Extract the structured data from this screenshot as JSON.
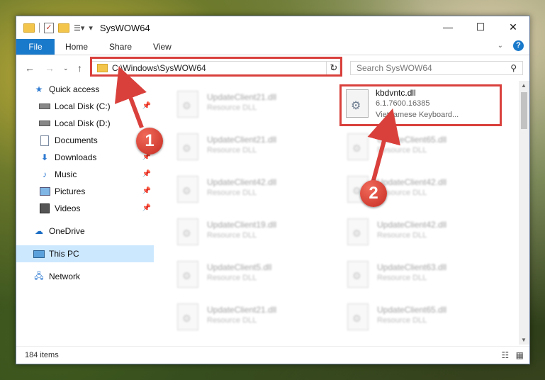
{
  "window": {
    "title": "SysWOW64",
    "quick_access_toolbar": [
      "folder-icon",
      "checkmark-icon",
      "folder-icon",
      "properties-icon"
    ]
  },
  "ribbon": {
    "tabs": [
      {
        "label": "File"
      },
      {
        "label": "Home"
      },
      {
        "label": "Share"
      },
      {
        "label": "View"
      }
    ]
  },
  "navigation": {
    "address_path": "C:\\Windows\\SysWOW64",
    "search_placeholder": "Search SysWOW64"
  },
  "sidebar": {
    "items": [
      {
        "label": "Quick access",
        "icon": "star-icon",
        "pinned": false
      },
      {
        "label": "Local Disk (C:)",
        "icon": "drive-icon",
        "pinned": true
      },
      {
        "label": "Local Disk (D:)",
        "icon": "drive-icon",
        "pinned": false
      },
      {
        "label": "Documents",
        "icon": "documents-icon",
        "pinned": true
      },
      {
        "label": "Downloads",
        "icon": "download-icon",
        "pinned": true
      },
      {
        "label": "Music",
        "icon": "music-icon",
        "pinned": true
      },
      {
        "label": "Pictures",
        "icon": "pictures-icon",
        "pinned": true
      },
      {
        "label": "Videos",
        "icon": "video-icon",
        "pinned": true
      },
      {
        "label": "OneDrive",
        "icon": "cloud-icon",
        "pinned": false
      },
      {
        "label": "This PC",
        "icon": "computer-icon",
        "pinned": false,
        "selected": true
      },
      {
        "label": "Network",
        "icon": "network-icon",
        "pinned": false
      }
    ]
  },
  "files": {
    "highlighted": {
      "name": "kbdvntc.dll",
      "version": "6.1.7600.16385",
      "description": "Vietnamese Keyboard..."
    },
    "left_column": [
      {
        "name": "UpdateClient21.dll",
        "type": "Resource DLL"
      },
      {
        "name": "UpdateClient21.dll",
        "type": "Resource DLL"
      },
      {
        "name": "UpdateClient42.dll",
        "type": "Resource DLL"
      },
      {
        "name": "UpdateClient19.dll",
        "type": "Resource DLL"
      },
      {
        "name": "UpdateClient5.dll",
        "type": "Resource DLL"
      },
      {
        "name": "UpdateClient21.dll",
        "type": "Resource DLL"
      }
    ],
    "right_column": [
      {
        "name": "UpdateClient65.dll",
        "type": "Resource DLL"
      },
      {
        "name": "UpdateClient42.dll",
        "type": "Resource DLL"
      },
      {
        "name": "UpdateClient42.dll",
        "type": "Resource DLL"
      },
      {
        "name": "UpdateClient63.dll",
        "type": "Resource DLL"
      },
      {
        "name": "UpdateClient65.dll",
        "type": "Resource DLL"
      }
    ]
  },
  "status": {
    "item_count": "184 items"
  },
  "annotations": [
    {
      "label": "1"
    },
    {
      "label": "2"
    }
  ],
  "colors": {
    "file_tab": "#1979ca",
    "annotation_red": "#d9403c",
    "selected_nav": "#cce8ff"
  }
}
